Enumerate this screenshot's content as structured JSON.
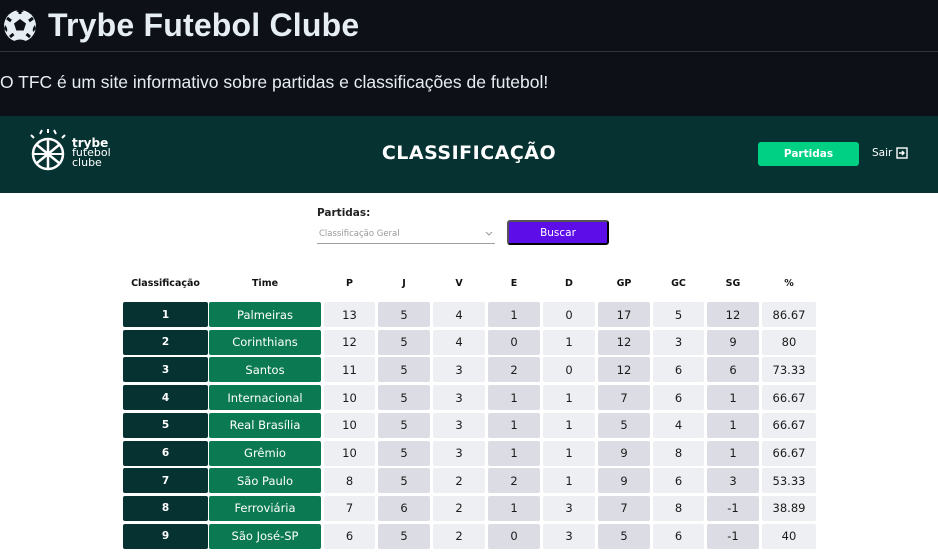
{
  "readme": {
    "title": "Trybe Futebol Clube",
    "description": "O TFC é um site informativo sobre partidas e classificações de futebol!"
  },
  "header": {
    "logo_line1": "trybe",
    "logo_line2": "futebol",
    "logo_line3": "clube",
    "title": "CLASSIFICAÇÃO",
    "partidas_button": "Partidas",
    "sair_button": "Sair"
  },
  "filter": {
    "label": "Partidas:",
    "selected": "Classificação Geral",
    "search_button": "Buscar"
  },
  "colors": {
    "header_bg": "#063232",
    "accent_green": "#00d084",
    "team_green": "#0b7a52",
    "button_purple": "#5c0de8"
  },
  "table": {
    "columns": [
      "Classificação",
      "Time",
      "P",
      "J",
      "V",
      "E",
      "D",
      "GP",
      "GC",
      "SG",
      "%"
    ],
    "rows": [
      [
        "1",
        "Palmeiras",
        "13",
        "5",
        "4",
        "1",
        "0",
        "17",
        "5",
        "12",
        "86.67"
      ],
      [
        "2",
        "Corinthians",
        "12",
        "5",
        "4",
        "0",
        "1",
        "12",
        "3",
        "9",
        "80"
      ],
      [
        "3",
        "Santos",
        "11",
        "5",
        "3",
        "2",
        "0",
        "12",
        "6",
        "6",
        "73.33"
      ],
      [
        "4",
        "Internacional",
        "10",
        "5",
        "3",
        "1",
        "1",
        "7",
        "6",
        "1",
        "66.67"
      ],
      [
        "5",
        "Real Brasília",
        "10",
        "5",
        "3",
        "1",
        "1",
        "5",
        "4",
        "1",
        "66.67"
      ],
      [
        "6",
        "Grêmio",
        "10",
        "5",
        "3",
        "1",
        "1",
        "9",
        "8",
        "1",
        "66.67"
      ],
      [
        "7",
        "São Paulo",
        "8",
        "5",
        "2",
        "2",
        "1",
        "9",
        "6",
        "3",
        "53.33"
      ],
      [
        "8",
        "Ferroviária",
        "7",
        "6",
        "2",
        "1",
        "3",
        "7",
        "8",
        "-1",
        "38.89"
      ],
      [
        "9",
        "São José-SP",
        "6",
        "5",
        "2",
        "0",
        "3",
        "5",
        "6",
        "-1",
        "40"
      ]
    ]
  }
}
